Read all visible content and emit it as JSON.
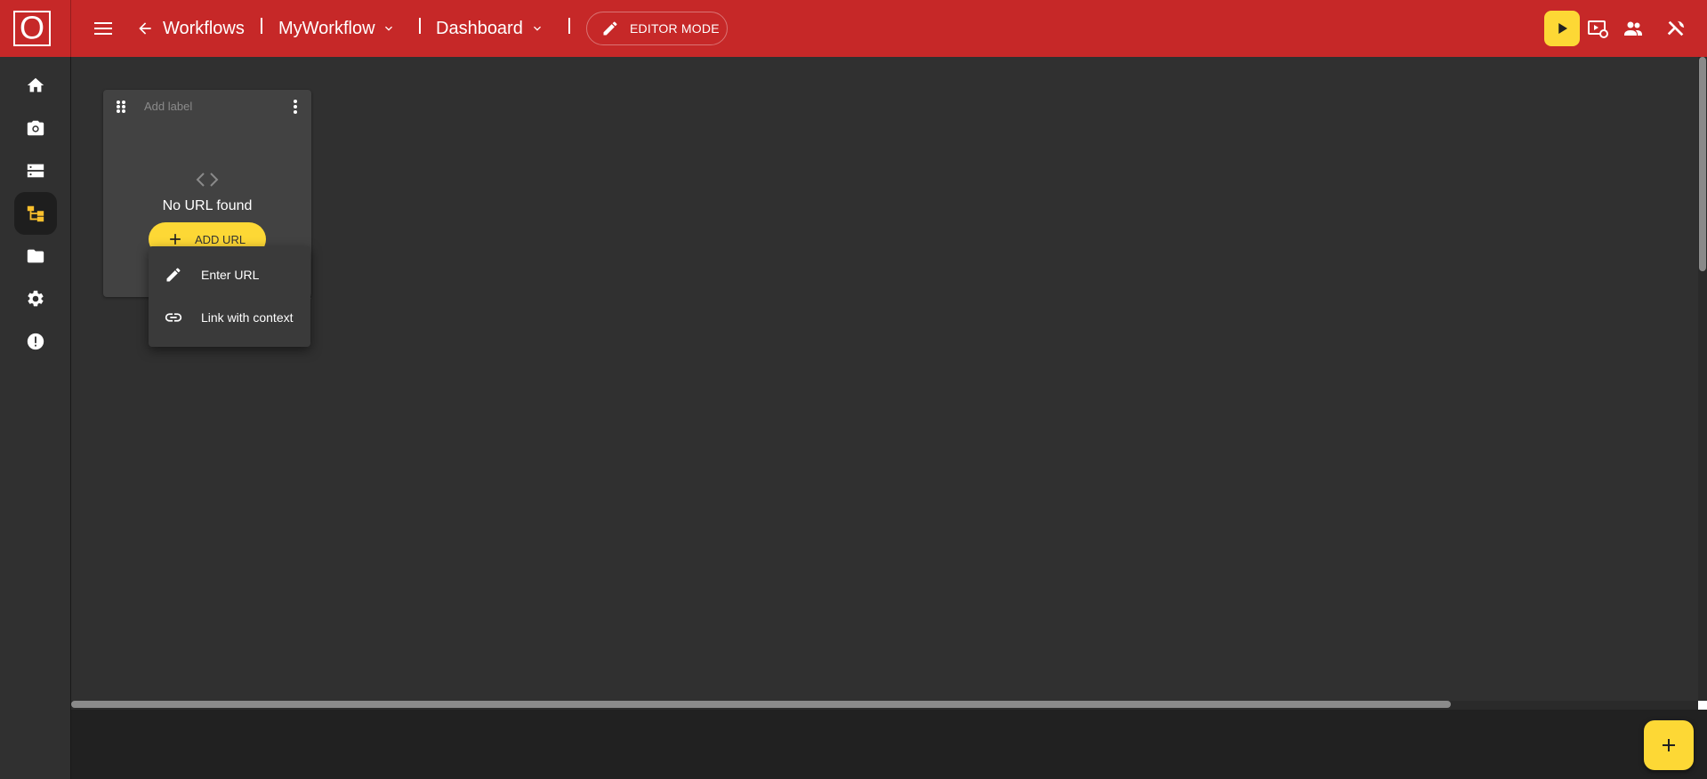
{
  "logo": {
    "letter": "O"
  },
  "header": {
    "back_label": "Workflows",
    "workflow_name": "MyWorkflow",
    "view_name": "Dashboard",
    "editor_mode_label": "EDITOR MODE"
  },
  "sidebar": {
    "items": [
      {
        "name": "home",
        "icon": "home-icon",
        "active": false
      },
      {
        "name": "camera",
        "icon": "camera-icon",
        "active": false
      },
      {
        "name": "storage",
        "icon": "storage-icon",
        "active": false
      },
      {
        "name": "workflows",
        "icon": "workflow-icon",
        "active": true
      },
      {
        "name": "files",
        "icon": "folder-icon",
        "active": false
      },
      {
        "name": "settings",
        "icon": "gear-icon",
        "active": false
      },
      {
        "name": "alerts",
        "icon": "alert-icon",
        "active": false
      }
    ]
  },
  "widget": {
    "label_placeholder": "Add label",
    "empty_message": "No URL found",
    "add_url_label": "ADD URL"
  },
  "dropdown": {
    "items": [
      {
        "label": "Enter URL",
        "icon": "pencil-icon"
      },
      {
        "label": "Link with context",
        "icon": "link-icon"
      }
    ]
  },
  "colors": {
    "header": "#c62828",
    "accent": "#fdd835",
    "background": "#303030",
    "bottom_bar": "#212121"
  }
}
